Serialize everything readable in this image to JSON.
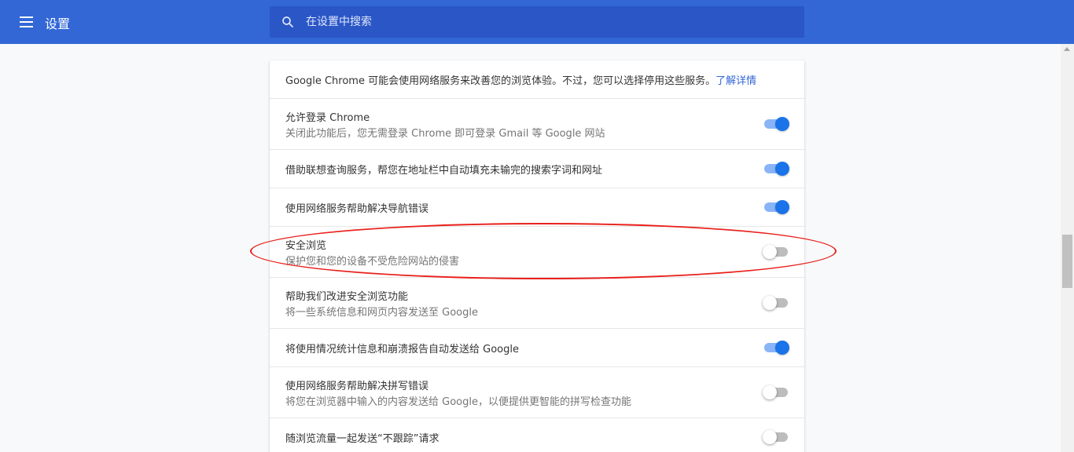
{
  "header": {
    "title": "设置",
    "search_placeholder": "在设置中搜索"
  },
  "intro": {
    "text": "Google Chrome 可能会使用网络服务来改善您的浏览体验。不过，您可以选择停用这些服务。",
    "link": "了解详情"
  },
  "settings": [
    {
      "title": "允许登录 Chrome",
      "subtitle": "关闭此功能后，您无需登录 Chrome 即可登录 Gmail 等 Google 网站",
      "enabled": true
    },
    {
      "title": "借助联想查询服务，帮您在地址栏中自动填充未输完的搜索字词和网址",
      "subtitle": "",
      "enabled": true
    },
    {
      "title": "使用网络服务帮助解决导航错误",
      "subtitle": "",
      "enabled": true
    },
    {
      "title": "安全浏览",
      "subtitle": "保护您和您的设备不受危险网站的侵害",
      "enabled": false
    },
    {
      "title": "帮助我们改进安全浏览功能",
      "subtitle": "将一些系统信息和网页内容发送至 Google",
      "enabled": false
    },
    {
      "title": "将使用情况统计信息和崩溃报告自动发送给 Google",
      "subtitle": "",
      "enabled": true
    },
    {
      "title": "使用网络服务帮助解决拼写错误",
      "subtitle": "将您在浏览器中输入的内容发送给 Google，以便提供更智能的拼写检查功能",
      "enabled": false
    },
    {
      "title": "随浏览流量一起发送“不跟踪”请求",
      "subtitle": "",
      "enabled": false
    }
  ],
  "colors": {
    "toolbar": "#3367d6",
    "toggle_on": "#1a73e8",
    "annotation": "#e8201b"
  }
}
